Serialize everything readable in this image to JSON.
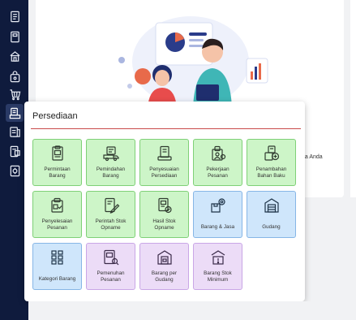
{
  "sidebar": {
    "items": [
      {
        "icon": "document-icon"
      },
      {
        "icon": "notebook-icon"
      },
      {
        "icon": "building-icon"
      },
      {
        "icon": "bag-icon"
      },
      {
        "icon": "cart-icon"
      },
      {
        "icon": "inventory-icon",
        "active": true
      },
      {
        "icon": "report-icon"
      },
      {
        "icon": "book-icon"
      },
      {
        "icon": "settings-doc-icon"
      }
    ]
  },
  "background": {
    "side_text": "ha Anda"
  },
  "panel": {
    "title": "Persediaan",
    "accent_color": "#c94a4a",
    "tiles": [
      {
        "label_lines": [
          "Permintaan",
          "Barang"
        ],
        "color": "green",
        "icon": "clipboard-doc-icon"
      },
      {
        "label_lines": [
          "Pemindahan",
          "Barang"
        ],
        "color": "green",
        "icon": "truck-icon"
      },
      {
        "label_lines": [
          "Penyesuaian",
          "Persediaan"
        ],
        "color": "green",
        "icon": "clipboard-check-icon"
      },
      {
        "label_lines": [
          "Pekerjaan",
          "Pesanan"
        ],
        "color": "green",
        "icon": "worker-doc-icon"
      },
      {
        "label_lines": [
          "Penambahan",
          "Bahan Baku"
        ],
        "color": "green",
        "icon": "doc-plus-icon"
      },
      {
        "label_lines": [
          "Penyelesaian",
          "Pesanan"
        ],
        "color": "green",
        "icon": "box-doc-icon"
      },
      {
        "label_lines": [
          "Perintah Stok",
          "Opname"
        ],
        "color": "green",
        "icon": "doc-pencil-icon"
      },
      {
        "label_lines": [
          "Hasil Stok",
          "Opname"
        ],
        "color": "green",
        "icon": "doc-check-icon"
      },
      {
        "label_lines": [
          "Barang & Jasa"
        ],
        "color": "blue",
        "icon": "box-gear-icon"
      },
      {
        "label_lines": [
          "Gudang"
        ],
        "color": "blue",
        "icon": "warehouse-icon"
      },
      {
        "label_lines": [
          "Kategori Barang"
        ],
        "color": "blue",
        "icon": "grid-list-icon"
      },
      {
        "label_lines": [
          "Pemenuhan",
          "Pesanan"
        ],
        "color": "purple",
        "icon": "doc-search-icon"
      },
      {
        "label_lines": [
          "Barang per",
          "Gudang"
        ],
        "color": "purple",
        "icon": "warehouse-box-icon"
      },
      {
        "label_lines": [
          "Barang Stok",
          "Minimum"
        ],
        "color": "purple",
        "icon": "warehouse-alert-icon"
      }
    ]
  }
}
